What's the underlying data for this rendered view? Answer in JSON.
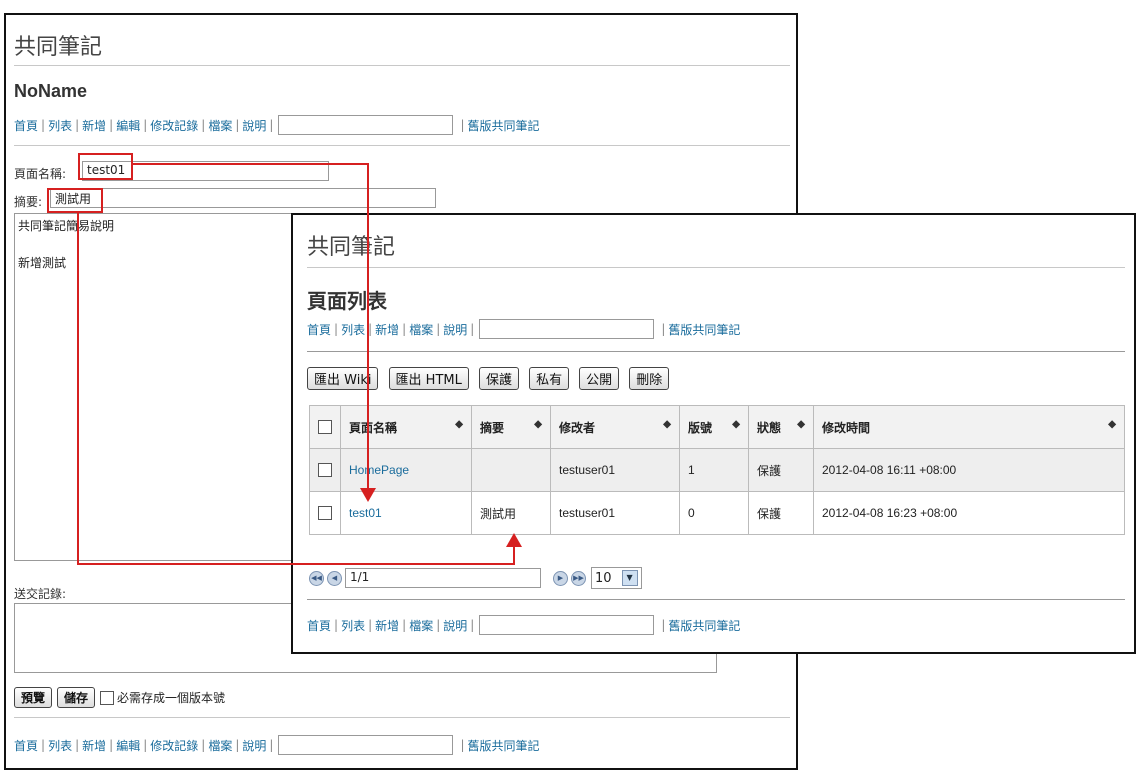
{
  "editor": {
    "app_title": "共同筆記",
    "page_title": "NoName",
    "nav": [
      "首頁",
      "列表",
      "新增",
      "編輯",
      "修改記錄",
      "檔案",
      "說明"
    ],
    "old_version_link": "舊版共同筆記",
    "page_name_label": "頁面名稱:",
    "page_name_value": "test01",
    "summary_label": "摘要:",
    "summary_value": "測試用",
    "content_line1": "共同筆記簡易說明",
    "content_line2": "新增測試",
    "commit_label": "送交記錄:",
    "preview_button": "預覽",
    "save_button": "儲存",
    "version_checkbox_label": "必需存成一個版本號"
  },
  "list": {
    "app_title": "共同筆記",
    "page_title": "頁面列表",
    "nav": [
      "首頁",
      "列表",
      "新增",
      "檔案",
      "說明"
    ],
    "old_version_link": "舊版共同筆記",
    "toolbar": [
      "匯出 Wiki",
      "匯出 HTML",
      "保護",
      "私有",
      "公開",
      "刪除"
    ],
    "columns": [
      "頁面名稱",
      "摘要",
      "修改者",
      "版號",
      "狀態",
      "修改時間"
    ],
    "rows": [
      {
        "name": "HomePage",
        "summary": "",
        "editor": "testuser01",
        "version": "1",
        "status": "保護",
        "time": "2012-04-08 16:11 +08:00"
      },
      {
        "name": "test01",
        "summary": "測試用",
        "editor": "testuser01",
        "version": "0",
        "status": "保護",
        "time": "2012-04-08 16:23 +08:00"
      }
    ],
    "pager_value": "1/1",
    "page_size": "10"
  },
  "colors": {
    "link": "#1a6c9c",
    "annotation": "#d62020"
  }
}
